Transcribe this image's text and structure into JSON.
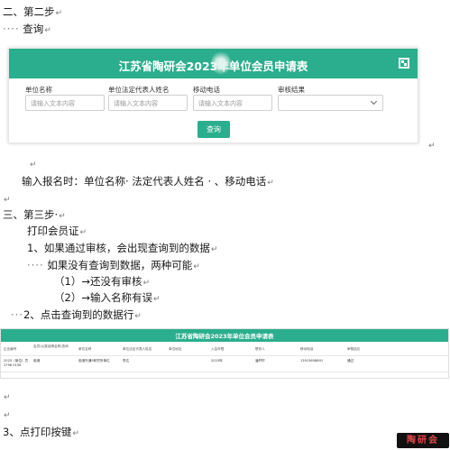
{
  "doc": {
    "step2_heading": "二、第二步",
    "step2_query": "查询",
    "enter_note": "输入报名时：单位名称· 法定代表人姓名 · 、移动电话",
    "step3_heading": "三、第三步·",
    "print_cert": "打印会员证",
    "item1": "1、如果通过审核，会出现查询到的数据",
    "item1_sub": "如果没有查询到数据，两种可能",
    "item1_a": "（1）→还没有审核",
    "item1_b": "（2）→输入名称有误",
    "item2": "2、点击查询到的数据行",
    "item3": "3、点打印按键"
  },
  "form": {
    "title": "江苏省陶研会2023年单位会员申请表",
    "fields": [
      {
        "label": "单位名称",
        "placeholder": "请输入文本内容"
      },
      {
        "label": "单位法定代表人姓名",
        "placeholder": "请输入文本内容"
      },
      {
        "label": "移动电话",
        "placeholder": "请输入文本内容"
      },
      {
        "label": "审核结果",
        "placeholder": ""
      }
    ],
    "query_button": "查询"
  },
  "table": {
    "title": "江苏省陶研会2023年单位会员申请表",
    "columns": [
      "企业编号",
      "会员(从属品牌名称)查询",
      "单位名称",
      "单位法定代表人姓名",
      "单位地址",
      "入会年限",
      "联系人",
      "移动电话",
      "审核结论"
    ],
    "rows": [
      [
        "2023（单位）员2796 0156",
        "临港",
        "临港东通5研究所单位",
        "李达",
        "",
        "2023年",
        "潘柠柠",
        "13913658891",
        "通过"
      ]
    ]
  },
  "logo_text": "陶研会"
}
